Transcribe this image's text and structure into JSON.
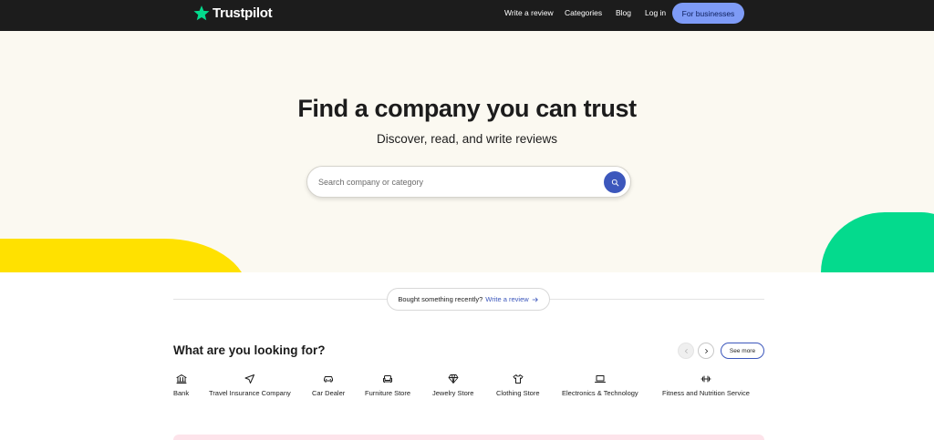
{
  "header": {
    "brand": "Trustpilot",
    "nav": [
      {
        "id": "write-review",
        "label": "Write a review"
      },
      {
        "id": "categories",
        "label": "Categories"
      },
      {
        "id": "blog",
        "label": "Blog"
      },
      {
        "id": "login",
        "label": "Log in"
      }
    ],
    "business_button": "For businesses"
  },
  "hero": {
    "title": "Find a company you can trust",
    "subtitle": "Discover, read, and write reviews",
    "search_placeholder": "Search company or category"
  },
  "prompt": {
    "text": "Bought something recently?",
    "link": "Write a review"
  },
  "categories": {
    "title": "What are you looking for?",
    "see_more": "See more",
    "items": [
      {
        "label": "Bank",
        "icon": "bank-icon"
      },
      {
        "label": "Travel Insurance Company",
        "icon": "airplane-icon"
      },
      {
        "label": "Car Dealer",
        "icon": "car-icon"
      },
      {
        "label": "Furniture Store",
        "icon": "sofa-icon"
      },
      {
        "label": "Jewelry Store",
        "icon": "diamond-icon"
      },
      {
        "label": "Clothing Store",
        "icon": "shirt-icon"
      },
      {
        "label": "Electronics & Technology",
        "icon": "laptop-icon"
      },
      {
        "label": "Fitness and Nutrition Service",
        "icon": "dumbbell-icon"
      }
    ]
  },
  "colors": {
    "header_bg": "#1c1c1c",
    "star_green": "#04da8d",
    "business_button_bg": "#7e9bf6",
    "hero_bg": "#fbf9f1",
    "search_button": "#3c57bc",
    "yellow_blob": "#ffe100",
    "green_blob": "#04da8d",
    "link_blue": "#3c57bc"
  }
}
